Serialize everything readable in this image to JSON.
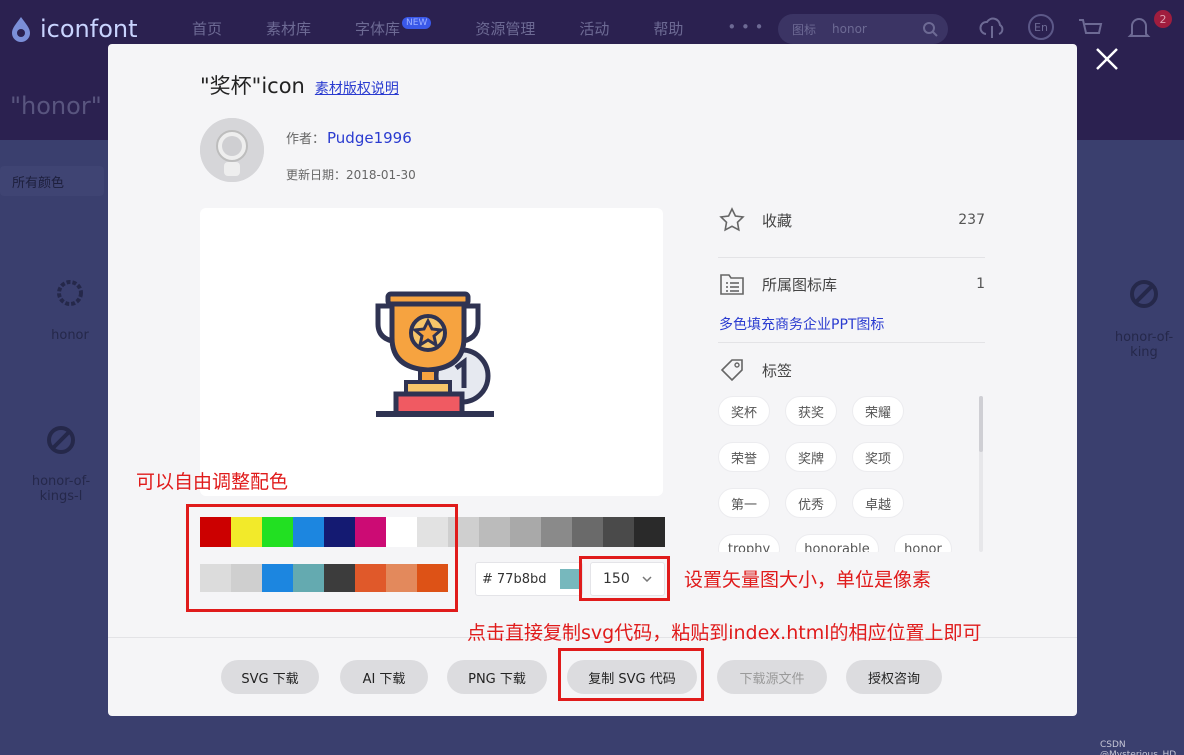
{
  "background": {
    "logo_text": "iconfont",
    "nav": [
      "首页",
      "素材库",
      "字体库",
      "资源管理",
      "活动",
      "帮助",
      "• • •"
    ],
    "nav_new_badge": "NEW",
    "search_scope": "图标",
    "search_query": "honor",
    "lang_label": "En",
    "notification_count": "2",
    "page_query": "\"honor\"",
    "color_filter": "所有颜色",
    "icon_labels": [
      "honor",
      "honor-of-kings-l",
      "honor-of-king"
    ]
  },
  "modal": {
    "title": "\"奖杯\"icon",
    "copyright_link": "素材版权说明",
    "author_label": "作者：",
    "author_name": "Pudge1996",
    "date_label": "更新日期：",
    "date_value": "2018-01-30",
    "favorites": {
      "label": "收藏",
      "count": "237"
    },
    "library": {
      "label": "所属图标库",
      "count": "1",
      "name": "多色填充商务企业PPT图标"
    },
    "tags_label": "标签",
    "tags": [
      "奖杯",
      "获奖",
      "荣耀",
      "荣誉",
      "奖牌",
      "奖项",
      "第一",
      "优秀",
      "卓越",
      "trophy",
      "honorable",
      "honor"
    ],
    "palette_top": [
      "#cc0000",
      "#f2ea2a",
      "#22e022",
      "#1c86e0",
      "#141a72",
      "#cc0b74",
      "#ffffff",
      "#e2e2e2",
      "#cfcfcf",
      "#bbbbbb",
      "#a9a9a9",
      "#8a8a8a",
      "#6a6a6a",
      "#4a4a4a",
      "#2a2a2a"
    ],
    "palette_bottom": [
      "#dcdcdc",
      "#cfcfcf",
      "#1c86e0",
      "#64aab0",
      "#3c3c3c",
      "#e0592a",
      "#e3895c",
      "#dd5216"
    ],
    "hex_prefix": "#",
    "hex_value": "77b8bd",
    "hex_color": "#77b8bd",
    "size_value": "150",
    "buttons": [
      "SVG 下载",
      "AI 下载",
      "PNG 下载",
      "复制 SVG 代码",
      "下载源文件",
      "授权咨询"
    ]
  },
  "annotations": {
    "color_note": "可以自由调整配色",
    "size_note": "设置矢量图大小，单位是像素",
    "copy_note": "点击直接复制svg代码，粘贴到index.html的相应位置上即可"
  },
  "watermark": "CSDN @Mysterious_HD"
}
